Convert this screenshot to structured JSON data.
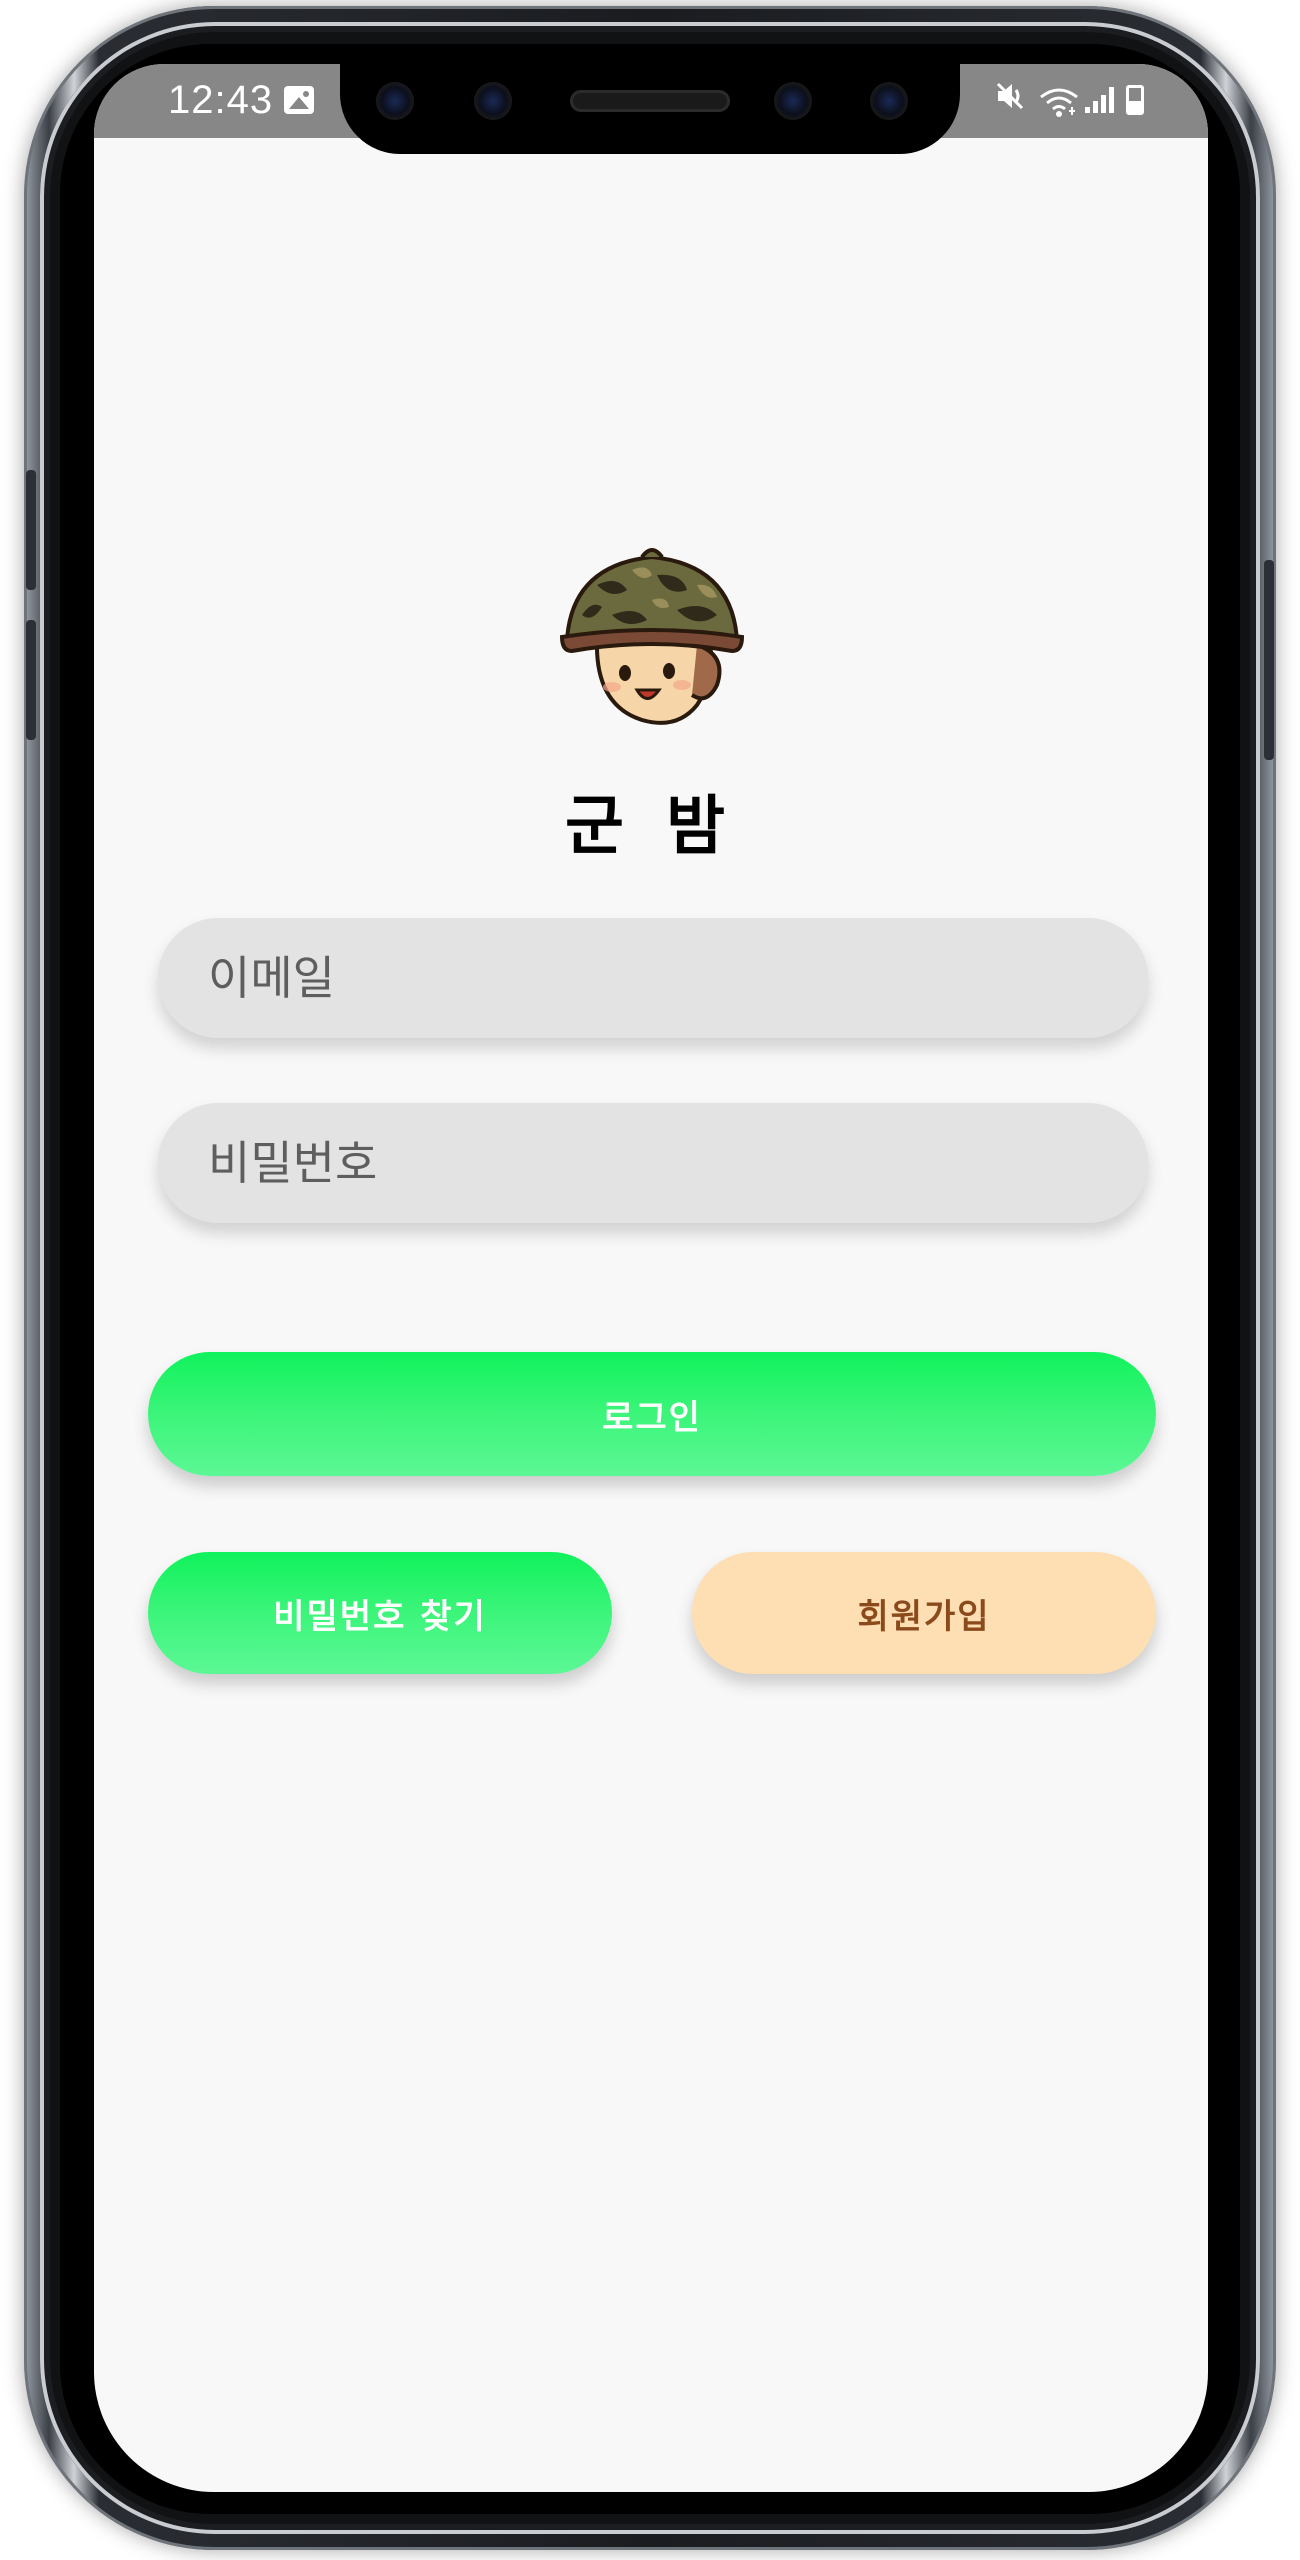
{
  "status_bar": {
    "time": "12:43",
    "icons_left": [
      "gallery-icon"
    ],
    "icons_right": [
      "mute-icon",
      "wifi-icon",
      "signal-icon",
      "battery-icon"
    ],
    "background": "#878787"
  },
  "app": {
    "title": "군 밤",
    "logo": "soldier-mascot-icon"
  },
  "form": {
    "email_placeholder": "이메일",
    "email_value": "",
    "password_placeholder": "비밀번호",
    "password_value": ""
  },
  "buttons": {
    "login_label": "로그인",
    "find_password_label": "비밀번호 찾기",
    "signup_label": "회원가입"
  },
  "colors": {
    "primary_green": "#10f25c",
    "signup_peach": "#fddfb3",
    "signup_text": "#8a4a1c",
    "field_bg": "#e3e3e3",
    "screen_bg": "#f8f8f8"
  }
}
